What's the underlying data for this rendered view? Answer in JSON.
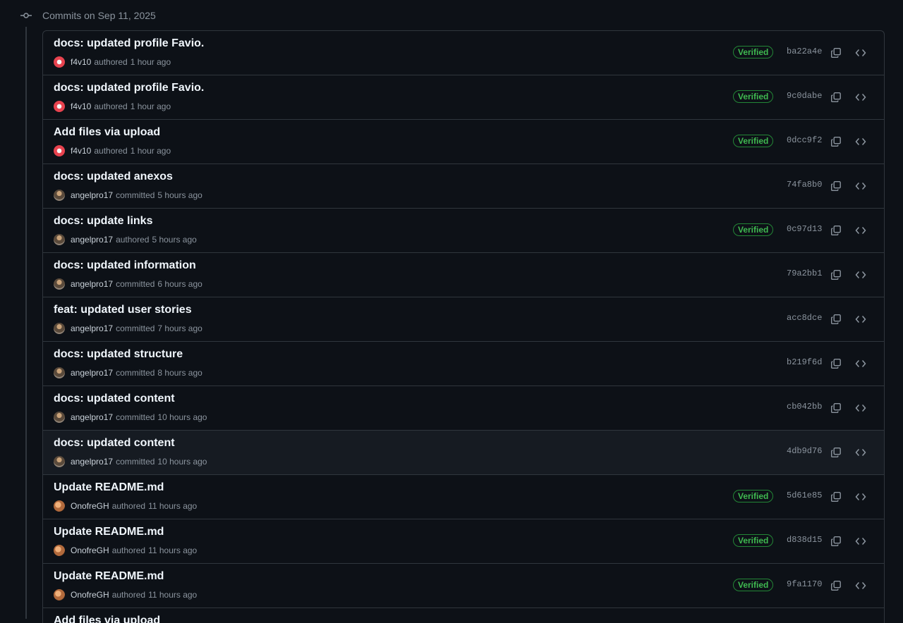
{
  "header": {
    "text": "Commits on Sep 11, 2025"
  },
  "verified_label": "Verified",
  "commits": [
    {
      "title": "docs: updated profile Favio.",
      "author": "f4v10",
      "action": "authored",
      "time": "1 hour ago",
      "verified": true,
      "sha": "ba22a4e",
      "avatar": "red"
    },
    {
      "title": "docs: updated profile Favio.",
      "author": "f4v10",
      "action": "authored",
      "time": "1 hour ago",
      "verified": true,
      "sha": "9c0dabe",
      "avatar": "red"
    },
    {
      "title": "Add files via upload",
      "author": "f4v10",
      "action": "authored",
      "time": "1 hour ago",
      "verified": true,
      "sha": "0dcc9f2",
      "avatar": "red"
    },
    {
      "title": "docs: updated anexos",
      "author": "angelpro17",
      "action": "committed",
      "time": "5 hours ago",
      "verified": false,
      "sha": "74fa8b0",
      "avatar": "brown"
    },
    {
      "title": "docs: update links",
      "author": "angelpro17",
      "action": "authored",
      "time": "5 hours ago",
      "verified": true,
      "sha": "0c97d13",
      "avatar": "brown"
    },
    {
      "title": "docs: updated information",
      "author": "angelpro17",
      "action": "committed",
      "time": "6 hours ago",
      "verified": false,
      "sha": "79a2bb1",
      "avatar": "brown"
    },
    {
      "title": "feat: updated user stories",
      "author": "angelpro17",
      "action": "committed",
      "time": "7 hours ago",
      "verified": false,
      "sha": "acc8dce",
      "avatar": "brown"
    },
    {
      "title": "docs: updated structure",
      "author": "angelpro17",
      "action": "committed",
      "time": "8 hours ago",
      "verified": false,
      "sha": "b219f6d",
      "avatar": "brown"
    },
    {
      "title": "docs: updated content",
      "author": "angelpro17",
      "action": "committed",
      "time": "10 hours ago",
      "verified": false,
      "sha": "cb042bb",
      "avatar": "brown"
    },
    {
      "title": "docs: updated content",
      "author": "angelpro17",
      "action": "committed",
      "time": "10 hours ago",
      "verified": false,
      "sha": "4db9d76",
      "avatar": "brown",
      "highlight": true
    },
    {
      "title": "Update README.md",
      "author": "OnofreGH",
      "action": "authored",
      "time": "11 hours ago",
      "verified": true,
      "sha": "5d61e85",
      "avatar": "orange"
    },
    {
      "title": "Update README.md",
      "author": "OnofreGH",
      "action": "authored",
      "time": "11 hours ago",
      "verified": true,
      "sha": "d838d15",
      "avatar": "orange"
    },
    {
      "title": "Update README.md",
      "author": "OnofreGH",
      "action": "authored",
      "time": "11 hours ago",
      "verified": true,
      "sha": "9fa1170",
      "avatar": "orange"
    },
    {
      "title": "Add files via upload",
      "author": "",
      "action": "",
      "time": "",
      "verified": false,
      "sha": "",
      "avatar": ""
    }
  ],
  "icons": {
    "header": "git-commit-icon",
    "copy": "copy-icon",
    "browse": "code-icon"
  },
  "colors": {
    "background": "#0d1117",
    "verified": "#3fb950",
    "border": "#30363d",
    "muted": "#8b949e"
  }
}
